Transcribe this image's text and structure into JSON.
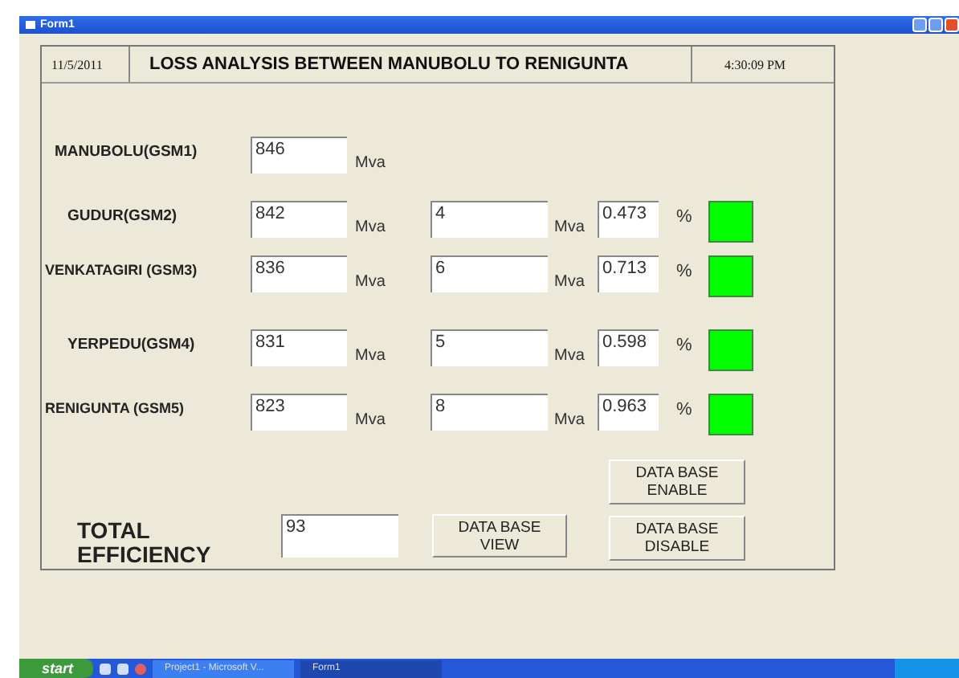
{
  "window": {
    "title": "Form1"
  },
  "header": {
    "date": "11/5/2011",
    "title": "LOSS ANALYSIS BETWEEN MANUBOLU TO RENIGUNTA",
    "time": "4:30:09 PM"
  },
  "stations": [
    {
      "name": "MANUBOLU(GSM1)",
      "power": "846",
      "power_unit": "Mva"
    },
    {
      "name": "GUDUR(GSM2)",
      "power": "842",
      "power_unit": "Mva",
      "loss": "4",
      "loss_unit": "Mva",
      "percent": "0.473",
      "percent_unit": "%",
      "color": "#00ff00"
    },
    {
      "name": "VENKATAGIRI (GSM3)",
      "power": "836",
      "power_unit": "Mva",
      "loss": "6",
      "loss_unit": "Mva",
      "percent": "0.713",
      "percent_unit": "%",
      "color": "#00ff00"
    },
    {
      "name": "YERPEDU(GSM4)",
      "power": "831",
      "power_unit": "Mva",
      "loss": "5",
      "loss_unit": "Mva",
      "percent": "0.598",
      "percent_unit": "%",
      "color": "#00ff00"
    },
    {
      "name": "RENIGUNTA (GSM5)",
      "power": "823",
      "power_unit": "Mva",
      "loss": "8",
      "loss_unit": "Mva",
      "percent": "0.963",
      "percent_unit": "%",
      "color": "#00ff00"
    }
  ],
  "total": {
    "label": "TOTAL EFFICIENCY",
    "value": "93"
  },
  "buttons": {
    "view": "DATA BASE VIEW",
    "enable": "DATA BASE ENABLE",
    "disable": "DATA BASE DISABLE"
  },
  "taskbar": {
    "start": "start",
    "tasks": [
      {
        "label": "Project1 - Microsoft V...",
        "selected": false
      },
      {
        "label": "Form1",
        "selected": true
      }
    ]
  }
}
